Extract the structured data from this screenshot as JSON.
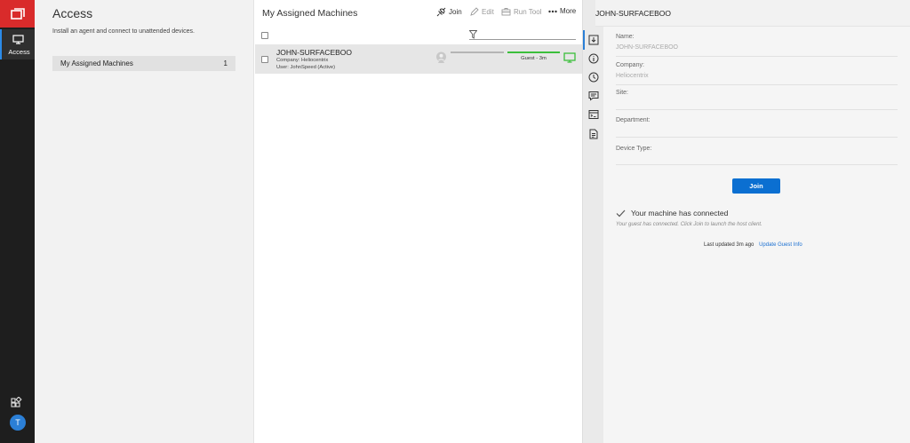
{
  "nav": {
    "access_label": "Access",
    "avatar_initial": "T"
  },
  "access": {
    "title": "Access",
    "subtitle": "Install an agent and connect to unattended devices.",
    "groups": [
      {
        "label": "My Assigned Machines",
        "count": "1"
      }
    ]
  },
  "machines": {
    "title": "My Assigned Machines",
    "toolbar": {
      "join": "Join",
      "edit": "Edit",
      "run_tool": "Run Tool",
      "more": "More"
    },
    "rows": [
      {
        "name": "JOHN-SURFACEBOO",
        "company": "Company: Heliocentrix",
        "user": "User: JohnSpeed (Active)",
        "guest_status": "Guest - 3m"
      }
    ]
  },
  "details": {
    "title": "JOHN-SURFACEBOO",
    "fields": {
      "name_label": "Name:",
      "name_value": "JOHN-SURFACEBOO",
      "company_label": "Company:",
      "company_value": "Heliocentrix",
      "site_label": "Site:",
      "department_label": "Department:",
      "device_type_label": "Device Type:"
    },
    "join_button": "Join",
    "connected_title": "Your machine has connected",
    "connected_sub": "Your guest has connected. Click Join to launch the host client.",
    "last_updated": "Last updated 3m ago",
    "update_link": "Update Guest Info"
  },
  "colors": {
    "brand_red": "#d92b2b",
    "accent_blue": "#0b6fd1",
    "online_green": "#3bbf3b"
  }
}
